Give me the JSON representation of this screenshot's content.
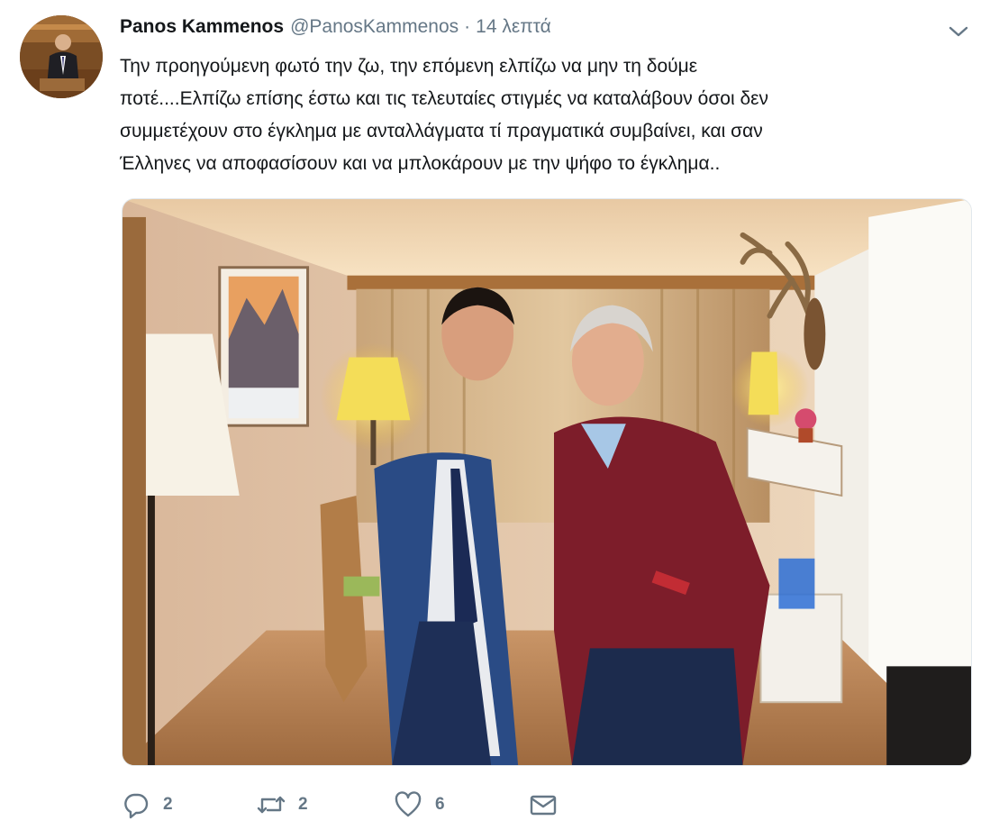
{
  "tweet": {
    "author_name": "Panos Kammenos",
    "handle": "@PanosKammenos",
    "separator": "·",
    "time": "14 λεπτά",
    "text_lines": [
      "Την προηγούμενη φωτό την ζω, την επόμενη ελπίζω να μην τη δούμε",
      "ποτέ....Ελπίζω επίσης έστω και τις τελευταίες στιγμές να καταλάβουν όσοι δεν",
      "συμμετέχουν στο έγκλημα με ανταλλάγματα τί πραγματικά συμβαίνει, και σαν",
      "Έλληνες να αποφασίσουν και να μπλοκάρουν με την ψήφο το έγκλημα.."
    ]
  },
  "actions": {
    "reply_count": "2",
    "retweet_count": "2",
    "like_count": "6"
  },
  "icons": {
    "caret": "chevron-down-icon",
    "reply": "reply-icon",
    "retweet": "retweet-icon",
    "like": "heart-icon",
    "dm": "envelope-icon"
  },
  "colors": {
    "text": "#14171a",
    "secondary": "#657786",
    "border": "#e1e8ed"
  }
}
